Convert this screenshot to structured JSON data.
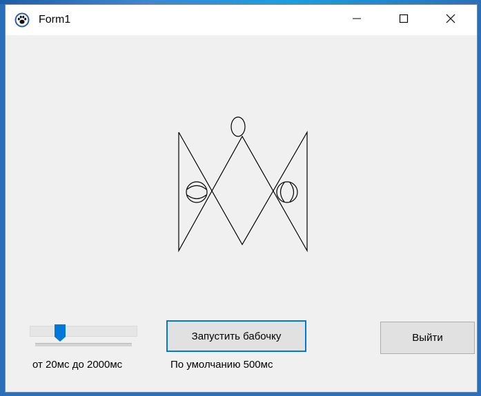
{
  "window": {
    "title": "Form1",
    "app_icon": "paw-icon",
    "controls": {
      "minimize_icon": "minimize-icon",
      "maximize_icon": "maximize-icon",
      "close_icon": "close-icon"
    }
  },
  "canvas": {
    "drawing": "butterfly",
    "stroke_color": "#000000"
  },
  "controls": {
    "speed_slider": {
      "range_label": "от 20мс до 2000мс",
      "accent_color": "#0078d7"
    },
    "start_button": {
      "label": "Запустить бабочку"
    },
    "default_label": "По умолчанию 500мс",
    "exit_button": {
      "label": "Выйти"
    }
  },
  "colors": {
    "window_bg": "#f0f0f0",
    "titlebar_bg": "#ffffff",
    "focus_border": "#0078d7",
    "button_bg": "#e1e1e1"
  }
}
